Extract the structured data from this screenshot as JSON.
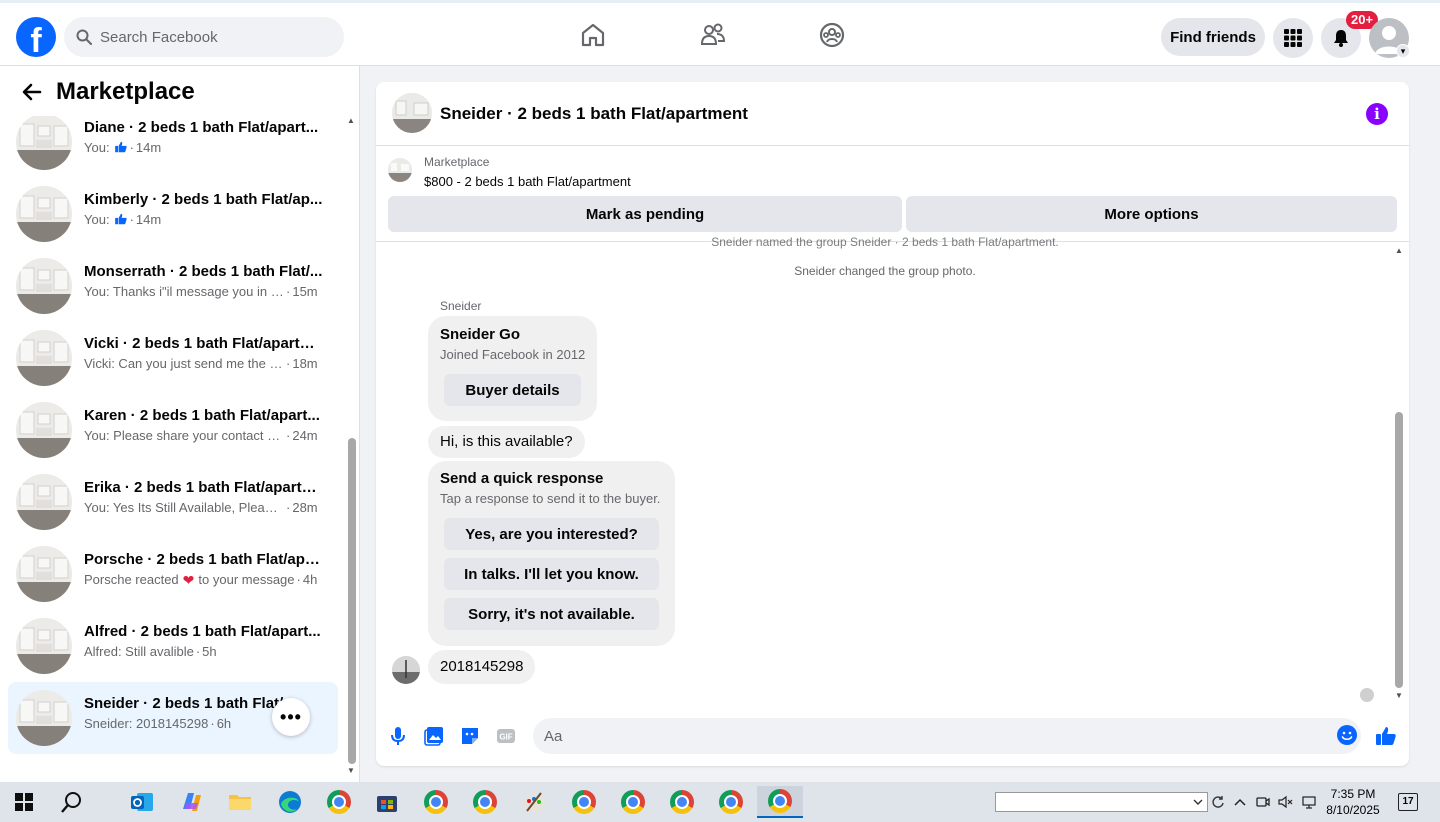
{
  "topbar": {
    "logo": "f",
    "search_placeholder": "Search Facebook",
    "find_friends": "Find friends",
    "notifications_badge": "20+"
  },
  "sidebar": {
    "title": "Marketplace",
    "conversations": [
      {
        "name": "Diane · 2 beds 1 bath Flat/apart...",
        "preview": "You: ",
        "preview_icon": "like",
        "time": "14m"
      },
      {
        "name": "Kimberly · 2 beds 1 bath Flat/ap...",
        "preview": "You: ",
        "preview_icon": "like",
        "time": "14m"
      },
      {
        "name": "Monserrath · 2 beds 1 bath Flat/...",
        "preview": "You: Thanks i\"il message you in a ...",
        "time": "15m"
      },
      {
        "name": "Vicki · 2 beds 1 bath Flat/apartm...",
        "preview": "Vicki: Can you just send me the q...",
        "time": "18m"
      },
      {
        "name": "Karen · 2 beds 1 bath Flat/apart...",
        "preview": "You: Please share your contact nu...",
        "time": "24m"
      },
      {
        "name": "Erika · 2 beds 1 bath Flat/apartm...",
        "preview": "You: Yes Its Still Available, Please ...",
        "time": "28m"
      },
      {
        "name": "Porsche · 2 beds 1 bath Flat/apar...",
        "preview": "Porsche reacted",
        "preview_icon": "heart",
        "preview_suffix": "to your message",
        "time": "4h"
      },
      {
        "name": "Alfred · 2 beds 1 bath Flat/apart...",
        "preview": "Alfred: Still avalible",
        "time": "5h"
      },
      {
        "name": "Sneider · 2 beds 1 bath Flat/a...",
        "preview": "Sneider: 2018145298",
        "time": "6h",
        "active": true
      }
    ]
  },
  "chat": {
    "title": "Sneider · 2 beds 1 bath Flat/apartment",
    "listing_label": "Marketplace",
    "listing_price": "$800 - 2 beds 1 bath Flat/apartment",
    "mark_pending": "Mark as pending",
    "more_options": "More options",
    "system_messages": [
      "Sneider named the group Sneider · 2 beds 1 bath Flat/apartment.",
      "Sneider changed the group photo."
    ],
    "sender": "Sneider",
    "profile_name": "Sneider Go",
    "profile_sub": "Joined Facebook in 2012",
    "buyer_details": "Buyer details",
    "message_1": "Hi, is this available?",
    "quick_title": "Send a quick response",
    "quick_sub": "Tap a response to send it to the buyer.",
    "quick_responses": [
      "Yes, are you interested?",
      "In talks. I'll let you know.",
      "Sorry, it's not available."
    ],
    "message_2": "2018145298",
    "composer_placeholder": "Aa"
  },
  "taskbar": {
    "time": "7:35 PM",
    "date": "8/10/2025",
    "notifications": "17"
  }
}
